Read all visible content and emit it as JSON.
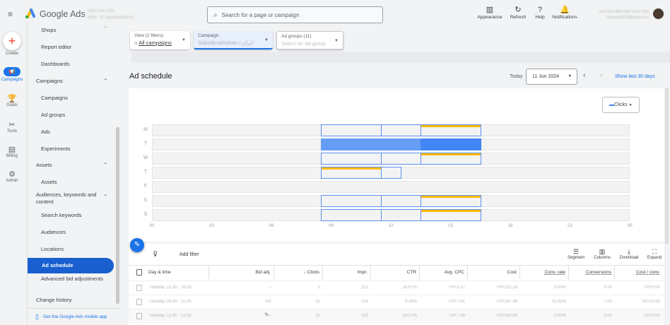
{
  "header": {
    "app_name": "Google Ads",
    "account_line1": "HDM Team 2020",
    "account_line2": "HDM · ID Sabzderakhshan",
    "search_placeholder": "Search for a page or campaign",
    "actions": [
      {
        "label": "Appearance",
        "icon": "appearance-icon",
        "glyph": "▥"
      },
      {
        "label": "Refresh",
        "icon": "refresh-icon",
        "glyph": "↻"
      },
      {
        "label": "Help",
        "icon": "help-icon",
        "glyph": "?"
      },
      {
        "label": "Notifications",
        "icon": "bell-icon",
        "glyph": "🔔"
      }
    ],
    "user_line1": "608-458-2488 HDM Team 2020",
    "user_line2": "hdmteam2020@gmail.com"
  },
  "rail": [
    {
      "label": "Create",
      "glyph": "+"
    },
    {
      "label": "Campaigns",
      "glyph": "📢"
    },
    {
      "label": "Goals",
      "glyph": "🏆"
    },
    {
      "label": "Tools",
      "glyph": "✂"
    },
    {
      "label": "Billing",
      "glyph": "▤"
    },
    {
      "label": "Admin",
      "glyph": "⚙"
    }
  ],
  "nav": {
    "items": [
      "Shops",
      "Report editor",
      "Dashboards",
      "Campaigns",
      "Campaigns",
      "Ad groups",
      "Ads",
      "Experiments",
      "Assets",
      "Assets",
      "Audiences, keywords and content",
      "Search keywords",
      "Audiences",
      "Locations",
      "Ad schedule",
      "Advanced bid adjustments",
      "Change history"
    ],
    "mobile_app": "Get the Google Ads mobile app"
  },
  "filters": {
    "view_label": "View (2 filters)",
    "view_value": "All campaigns",
    "campaign_label": "Campaign",
    "campaign_value": "Sabzderakhshan | ایران",
    "adgroups_label": "Ad groups (11)",
    "adgroups_value": "Select an ad group"
  },
  "page": {
    "title": "Ad schedule",
    "today": "Today",
    "date": "11 Jun 2024",
    "show_last": "Show last 30 days",
    "metric": "Clicks"
  },
  "chart_data": {
    "type": "heatmap",
    "metric": "Clicks",
    "days": [
      "M",
      "T",
      "W",
      "T",
      "F",
      "S",
      "S"
    ],
    "x_ticks": [
      "00",
      "03",
      "06",
      "09",
      "12",
      "15",
      "18",
      "21",
      "00"
    ],
    "xlim": [
      0,
      24
    ],
    "slots": [
      {
        "day": 0,
        "start": 8.5,
        "end": 11.5,
        "level": 0,
        "highlight": false
      },
      {
        "day": 0,
        "start": 11.5,
        "end": 13.5,
        "level": 0,
        "highlight": false
      },
      {
        "day": 0,
        "start": 13.5,
        "end": 16.5,
        "level": 0,
        "highlight": true
      },
      {
        "day": 1,
        "start": 8.5,
        "end": 11.5,
        "level": 1,
        "highlight": false
      },
      {
        "day": 1,
        "start": 11.5,
        "end": 13.5,
        "level": 1,
        "highlight": false
      },
      {
        "day": 1,
        "start": 13.5,
        "end": 16.5,
        "level": 2,
        "highlight": false
      },
      {
        "day": 2,
        "start": 8.5,
        "end": 11.5,
        "level": 0,
        "highlight": false
      },
      {
        "day": 2,
        "start": 11.5,
        "end": 13.5,
        "level": 0,
        "highlight": false
      },
      {
        "day": 2,
        "start": 13.5,
        "end": 16.5,
        "level": 0,
        "highlight": true
      },
      {
        "day": 3,
        "start": 8.5,
        "end": 11.5,
        "level": 0,
        "highlight": true
      },
      {
        "day": 3,
        "start": 11.5,
        "end": 12.5,
        "level": 0,
        "highlight": false
      },
      {
        "day": 5,
        "start": 8.5,
        "end": 11.5,
        "level": 0,
        "highlight": false
      },
      {
        "day": 5,
        "start": 11.5,
        "end": 13.5,
        "level": 0,
        "highlight": false
      },
      {
        "day": 5,
        "start": 13.5,
        "end": 16.5,
        "level": 0,
        "highlight": true
      },
      {
        "day": 6,
        "start": 8.5,
        "end": 11.5,
        "level": 0,
        "highlight": false
      },
      {
        "day": 6,
        "start": 11.5,
        "end": 13.5,
        "level": 0,
        "highlight": false
      },
      {
        "day": 6,
        "start": 13.5,
        "end": 16.5,
        "level": 0,
        "highlight": true
      }
    ]
  },
  "toolbar": {
    "add_filter": "Add filter",
    "segment": "Segment",
    "columns": "Columns",
    "download": "Download",
    "expand": "Expand"
  },
  "table": {
    "headers": [
      "Day & time",
      "Bid adj.",
      "↓ Clicks",
      "Impr.",
      "CTR",
      "Avg. CPC",
      "Cost",
      "Conv. rate",
      "Conversions",
      "Cost / conv."
    ],
    "rows": [
      [
        "Tuesday, 13:30 - 16:30",
        "--",
        "3",
        "101",
        "16.67%",
        "TRY0.37",
        "TRY101.18",
        "0.00%",
        "0.00",
        "TRY0.00"
      ],
      [
        "Tuesday, 08:30 - 11:30",
        "0%",
        "22",
        "233",
        "9.36%",
        "TRY7.61",
        "TRY167.36",
        "31.82%",
        "7.00",
        "TRY23.91"
      ],
      [
        "Tuesday, 11:30 - 13:30",
        "--",
        "15",
        "101",
        "14.07%",
        "TRY7.48",
        "TRY164.54",
        "0.00%",
        "0.00",
        "TRY0.00"
      ]
    ]
  }
}
